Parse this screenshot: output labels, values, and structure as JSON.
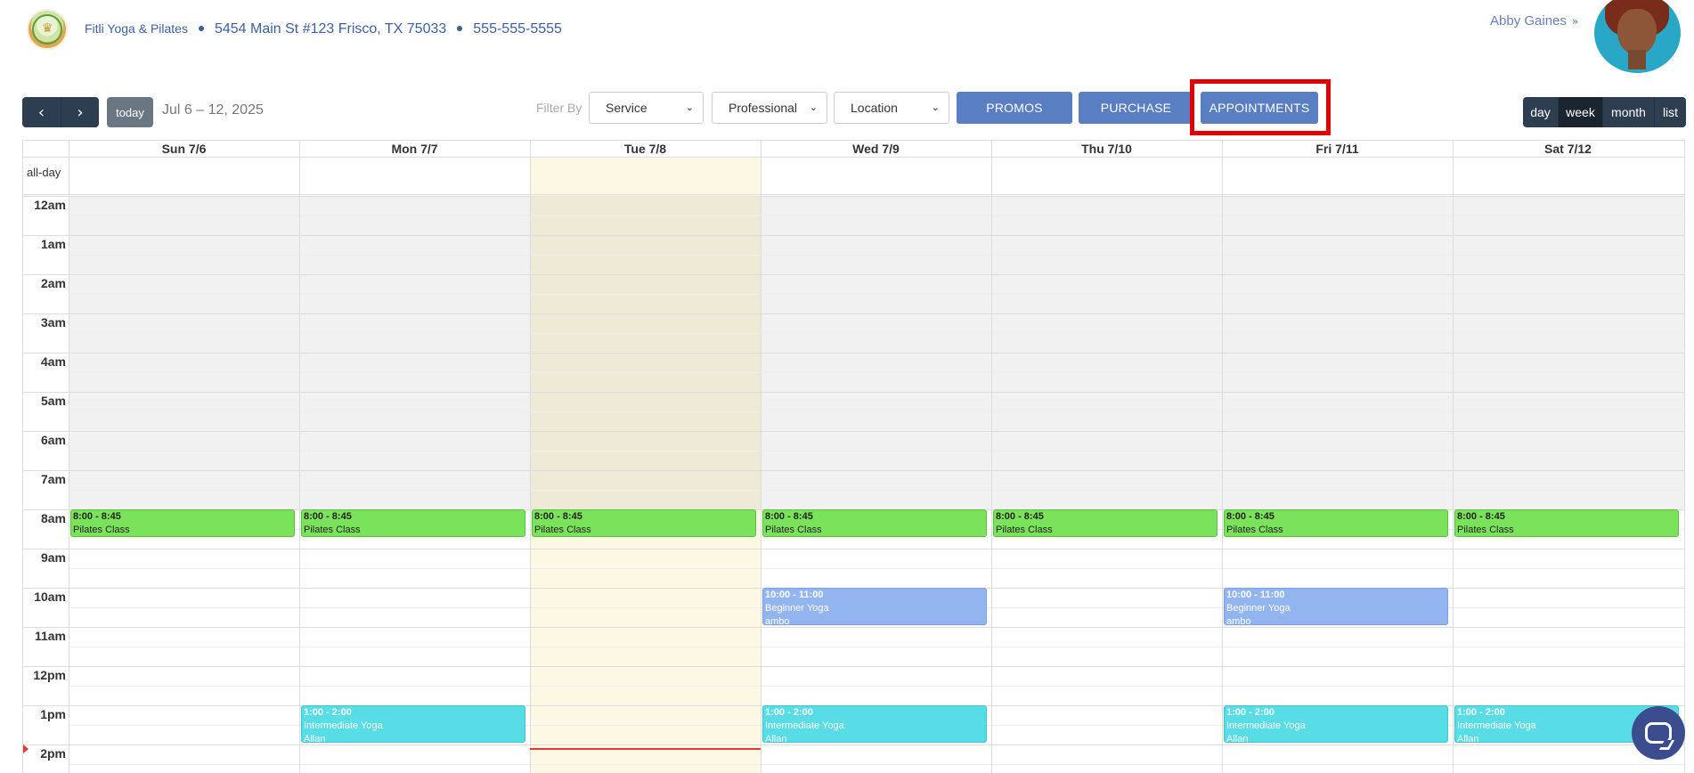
{
  "header": {
    "business_name": "Fitli Yoga & Pilates",
    "address": "5454 Main St #123 Frisco, TX 75033",
    "phone": "555-555-5555",
    "user_name": "Abby Gaines"
  },
  "toolbar": {
    "today_label": "today",
    "date_range": "Jul 6 – 12, 2025",
    "filter_label": "Filter By",
    "filters": [
      "Service",
      "Professional",
      "Location"
    ],
    "buttons": [
      "PROMOS",
      "PURCHASE",
      "APPOINTMENTS"
    ],
    "views": [
      "day",
      "week",
      "month",
      "list"
    ],
    "active_view": "week"
  },
  "calendar": {
    "allday_label": "all-day",
    "days": [
      "Sun 7/6",
      "Mon 7/7",
      "Tue 7/8",
      "Wed 7/9",
      "Thu 7/10",
      "Fri 7/11",
      "Sat 7/12"
    ],
    "today_index": 2,
    "hours": [
      "12am",
      "1am",
      "2am",
      "3am",
      "4am",
      "5am",
      "6am",
      "7am",
      "8am",
      "9am",
      "10am",
      "11am",
      "12pm",
      "1pm",
      "2pm"
    ],
    "business_hours_start": 8,
    "now_hour": 14.1,
    "events": [
      {
        "day": 0,
        "start": 8,
        "end": 8.75,
        "time": "8:00 - 8:45",
        "title": "Pilates Class",
        "instructor": "",
        "color": "green"
      },
      {
        "day": 1,
        "start": 8,
        "end": 8.75,
        "time": "8:00 - 8:45",
        "title": "Pilates Class",
        "instructor": "",
        "color": "green"
      },
      {
        "day": 2,
        "start": 8,
        "end": 8.75,
        "time": "8:00 - 8:45",
        "title": "Pilates Class",
        "instructor": "",
        "color": "green"
      },
      {
        "day": 3,
        "start": 8,
        "end": 8.75,
        "time": "8:00 - 8:45",
        "title": "Pilates Class",
        "instructor": "",
        "color": "green"
      },
      {
        "day": 4,
        "start": 8,
        "end": 8.75,
        "time": "8:00 - 8:45",
        "title": "Pilates Class",
        "instructor": "",
        "color": "green"
      },
      {
        "day": 5,
        "start": 8,
        "end": 8.75,
        "time": "8:00 - 8:45",
        "title": "Pilates Class",
        "instructor": "",
        "color": "green"
      },
      {
        "day": 6,
        "start": 8,
        "end": 8.75,
        "time": "8:00 - 8:45",
        "title": "Pilates Class",
        "instructor": "",
        "color": "green"
      },
      {
        "day": 3,
        "start": 10,
        "end": 11,
        "time": "10:00 - 11:00",
        "title": "Beginner Yoga",
        "instructor": "ambo",
        "color": "blue"
      },
      {
        "day": 5,
        "start": 10,
        "end": 11,
        "time": "10:00 - 11:00",
        "title": "Beginner Yoga",
        "instructor": "ambo",
        "color": "blue"
      },
      {
        "day": 1,
        "start": 13,
        "end": 14,
        "time": "1:00 - 2:00",
        "title": "Intermediate Yoga",
        "instructor": "Allan",
        "color": "cyan"
      },
      {
        "day": 3,
        "start": 13,
        "end": 14,
        "time": "1:00 - 2:00",
        "title": "Intermediate Yoga",
        "instructor": "Allan",
        "color": "cyan"
      },
      {
        "day": 5,
        "start": 13,
        "end": 14,
        "time": "1:00 - 2:00",
        "title": "Intermediate Yoga",
        "instructor": "Allan",
        "color": "cyan"
      },
      {
        "day": 6,
        "start": 13,
        "end": 14,
        "time": "1:00 - 2:00",
        "title": "Intermediate Yoga",
        "instructor": "Allan",
        "color": "cyan"
      }
    ]
  },
  "colors": {
    "nav_dark": "#2c3e50",
    "button_blue": "#5a7ec2",
    "highlight_red": "#e00000",
    "today_bg": "#fcf8e3",
    "event_green": "#7be35b",
    "event_blue": "#93b5ef",
    "event_cyan": "#58dde6"
  },
  "icons": {
    "prev": "chevron-left-icon",
    "next": "chevron-right-icon",
    "user_menu": "double-chevron-down-icon",
    "chat": "chat-icon"
  }
}
